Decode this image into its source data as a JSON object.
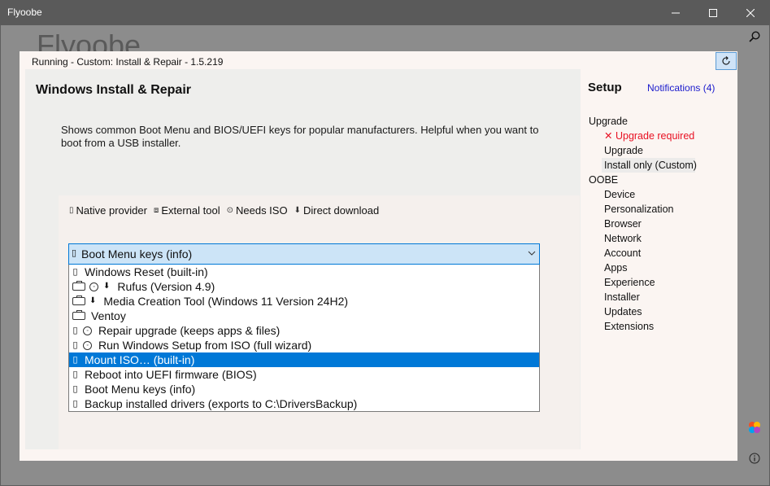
{
  "window": {
    "title": "Flyoobe",
    "bg_title": "Flyoobe"
  },
  "panel": {
    "running": "Running - Custom: Install & Repair - 1.5.219",
    "heading": "Windows Install & Repair",
    "description": "Shows common Boot Menu and BIOS/UEFI keys for popular manufacturers. Helpful when you want to boot from a USB installer."
  },
  "legend": {
    "native": "Native provider",
    "external": "External tool",
    "needs_iso": "Needs ISO",
    "direct": "Direct download"
  },
  "combo": {
    "selected": "Boot Menu keys (info)"
  },
  "options": [
    {
      "label": "Windows Reset (built-in)",
      "icons": [
        "native"
      ]
    },
    {
      "label": "Rufus (Version 4.9)",
      "icons": [
        "external",
        "iso",
        "download"
      ]
    },
    {
      "label": "Media Creation Tool (Windows 11 Version 24H2)",
      "icons": [
        "external",
        "download"
      ]
    },
    {
      "label": "Ventoy",
      "icons": [
        "external"
      ]
    },
    {
      "label": "Repair upgrade (keeps apps & files)",
      "icons": [
        "native",
        "iso"
      ]
    },
    {
      "label": "Run Windows Setup from ISO (full wizard)",
      "icons": [
        "native",
        "iso"
      ]
    },
    {
      "label": "Mount ISO… (built-in)",
      "icons": [
        "native"
      ],
      "highlighted": true
    },
    {
      "label": "Reboot into UEFI firmware (BIOS)",
      "icons": [
        "native"
      ]
    },
    {
      "label": "Boot Menu keys (info)",
      "icons": [
        "native"
      ]
    },
    {
      "label": "Backup installed drivers (exports to C:\\DriversBackup)",
      "icons": [
        "native"
      ]
    }
  ],
  "sidebar": {
    "setup": "Setup",
    "notifications": "Notifications (4)",
    "upgrade_section": "Upgrade",
    "upgrade_required": "Upgrade required",
    "upgrade": "Upgrade",
    "install_only": "Install only (Custom)",
    "oobe_section": "OOBE",
    "oobe_items": [
      "Device",
      "Personalization",
      "Browser",
      "Network",
      "Account",
      "Apps",
      "Experience",
      "Installer",
      "Updates",
      "Extensions"
    ]
  },
  "colors": {
    "accent": "#0078d7",
    "warning": "#e81123",
    "link": "#1a1acc"
  }
}
